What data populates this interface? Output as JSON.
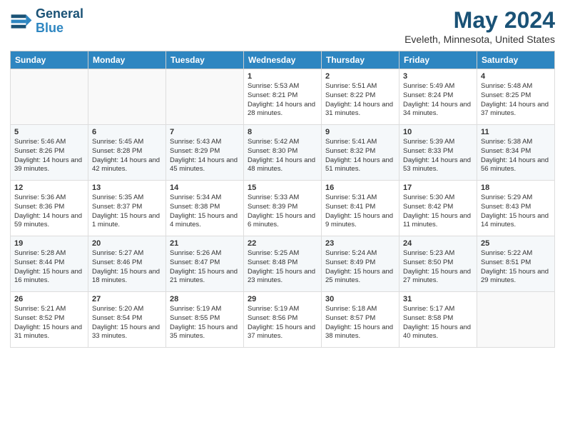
{
  "header": {
    "logo_line1": "General",
    "logo_line2": "Blue",
    "month": "May 2024",
    "location": "Eveleth, Minnesota, United States"
  },
  "days_of_week": [
    "Sunday",
    "Monday",
    "Tuesday",
    "Wednesday",
    "Thursday",
    "Friday",
    "Saturday"
  ],
  "weeks": [
    [
      {
        "day": "",
        "info": ""
      },
      {
        "day": "",
        "info": ""
      },
      {
        "day": "",
        "info": ""
      },
      {
        "day": "1",
        "info": "Sunrise: 5:53 AM\nSunset: 8:21 PM\nDaylight: 14 hours and 28 minutes."
      },
      {
        "day": "2",
        "info": "Sunrise: 5:51 AM\nSunset: 8:22 PM\nDaylight: 14 hours and 31 minutes."
      },
      {
        "day": "3",
        "info": "Sunrise: 5:49 AM\nSunset: 8:24 PM\nDaylight: 14 hours and 34 minutes."
      },
      {
        "day": "4",
        "info": "Sunrise: 5:48 AM\nSunset: 8:25 PM\nDaylight: 14 hours and 37 minutes."
      }
    ],
    [
      {
        "day": "5",
        "info": "Sunrise: 5:46 AM\nSunset: 8:26 PM\nDaylight: 14 hours and 39 minutes."
      },
      {
        "day": "6",
        "info": "Sunrise: 5:45 AM\nSunset: 8:28 PM\nDaylight: 14 hours and 42 minutes."
      },
      {
        "day": "7",
        "info": "Sunrise: 5:43 AM\nSunset: 8:29 PM\nDaylight: 14 hours and 45 minutes."
      },
      {
        "day": "8",
        "info": "Sunrise: 5:42 AM\nSunset: 8:30 PM\nDaylight: 14 hours and 48 minutes."
      },
      {
        "day": "9",
        "info": "Sunrise: 5:41 AM\nSunset: 8:32 PM\nDaylight: 14 hours and 51 minutes."
      },
      {
        "day": "10",
        "info": "Sunrise: 5:39 AM\nSunset: 8:33 PM\nDaylight: 14 hours and 53 minutes."
      },
      {
        "day": "11",
        "info": "Sunrise: 5:38 AM\nSunset: 8:34 PM\nDaylight: 14 hours and 56 minutes."
      }
    ],
    [
      {
        "day": "12",
        "info": "Sunrise: 5:36 AM\nSunset: 8:36 PM\nDaylight: 14 hours and 59 minutes."
      },
      {
        "day": "13",
        "info": "Sunrise: 5:35 AM\nSunset: 8:37 PM\nDaylight: 15 hours and 1 minute."
      },
      {
        "day": "14",
        "info": "Sunrise: 5:34 AM\nSunset: 8:38 PM\nDaylight: 15 hours and 4 minutes."
      },
      {
        "day": "15",
        "info": "Sunrise: 5:33 AM\nSunset: 8:39 PM\nDaylight: 15 hours and 6 minutes."
      },
      {
        "day": "16",
        "info": "Sunrise: 5:31 AM\nSunset: 8:41 PM\nDaylight: 15 hours and 9 minutes."
      },
      {
        "day": "17",
        "info": "Sunrise: 5:30 AM\nSunset: 8:42 PM\nDaylight: 15 hours and 11 minutes."
      },
      {
        "day": "18",
        "info": "Sunrise: 5:29 AM\nSunset: 8:43 PM\nDaylight: 15 hours and 14 minutes."
      }
    ],
    [
      {
        "day": "19",
        "info": "Sunrise: 5:28 AM\nSunset: 8:44 PM\nDaylight: 15 hours and 16 minutes."
      },
      {
        "day": "20",
        "info": "Sunrise: 5:27 AM\nSunset: 8:46 PM\nDaylight: 15 hours and 18 minutes."
      },
      {
        "day": "21",
        "info": "Sunrise: 5:26 AM\nSunset: 8:47 PM\nDaylight: 15 hours and 21 minutes."
      },
      {
        "day": "22",
        "info": "Sunrise: 5:25 AM\nSunset: 8:48 PM\nDaylight: 15 hours and 23 minutes."
      },
      {
        "day": "23",
        "info": "Sunrise: 5:24 AM\nSunset: 8:49 PM\nDaylight: 15 hours and 25 minutes."
      },
      {
        "day": "24",
        "info": "Sunrise: 5:23 AM\nSunset: 8:50 PM\nDaylight: 15 hours and 27 minutes."
      },
      {
        "day": "25",
        "info": "Sunrise: 5:22 AM\nSunset: 8:51 PM\nDaylight: 15 hours and 29 minutes."
      }
    ],
    [
      {
        "day": "26",
        "info": "Sunrise: 5:21 AM\nSunset: 8:52 PM\nDaylight: 15 hours and 31 minutes."
      },
      {
        "day": "27",
        "info": "Sunrise: 5:20 AM\nSunset: 8:54 PM\nDaylight: 15 hours and 33 minutes."
      },
      {
        "day": "28",
        "info": "Sunrise: 5:19 AM\nSunset: 8:55 PM\nDaylight: 15 hours and 35 minutes."
      },
      {
        "day": "29",
        "info": "Sunrise: 5:19 AM\nSunset: 8:56 PM\nDaylight: 15 hours and 37 minutes."
      },
      {
        "day": "30",
        "info": "Sunrise: 5:18 AM\nSunset: 8:57 PM\nDaylight: 15 hours and 38 minutes."
      },
      {
        "day": "31",
        "info": "Sunrise: 5:17 AM\nSunset: 8:58 PM\nDaylight: 15 hours and 40 minutes."
      },
      {
        "day": "",
        "info": ""
      }
    ]
  ]
}
